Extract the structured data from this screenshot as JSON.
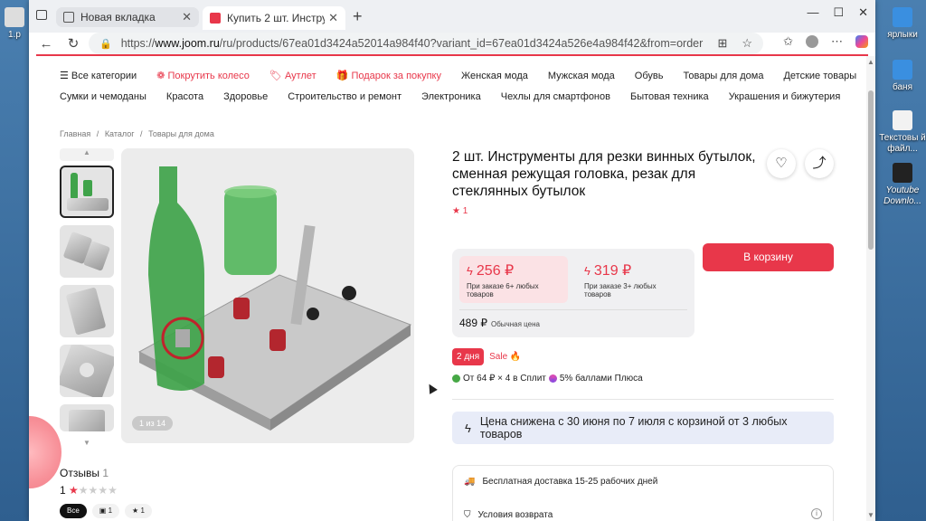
{
  "desktop": {
    "left_icon_label": "1.p",
    "icons": [
      {
        "label": "ярлыки"
      },
      {
        "label": "баня"
      },
      {
        "label": "Текстовы й файл..."
      },
      {
        "label": "Youtube Downlo..."
      }
    ]
  },
  "browser": {
    "tabs": [
      {
        "title": "Новая вкладка"
      },
      {
        "title": "Купить 2 шт. Инструменты д"
      }
    ],
    "address": {
      "prefix": "https://",
      "domain": "www.joom.ru",
      "path": "/ru/products/67ea01d3424a52014a984f40?variant_id=67ea01d3424a526e4a984f42&from=order"
    }
  },
  "catalog_nav": {
    "row1": [
      "Все категории",
      "Покрутить колесо",
      "Аутлет",
      "Подарок за покупку",
      "Женская мода",
      "Мужская мода",
      "Обувь",
      "Товары для дома",
      "Детские товары"
    ],
    "row2": [
      "Сумки и чемоданы",
      "Красота",
      "Здоровье",
      "Строительство и ремонт",
      "Электроника",
      "Чехлы для смартфонов",
      "Бытовая техника",
      "Украшения и бижутерия"
    ]
  },
  "breadcrumbs": [
    "Главная",
    "/",
    "Каталог",
    "/",
    "Товары для дома"
  ],
  "gallery": {
    "counter": "1 из 14"
  },
  "product": {
    "title": "2 шт. Инструменты для резки винных бутылок, сменная режущая головка, резак для стеклянных бутылок",
    "rating": "1"
  },
  "pricing": {
    "tier1_price": "256 ₽",
    "tier1_desc": "При заказе 6+ любых товаров",
    "tier2_price": "319 ₽",
    "tier2_desc": "При заказе 3+ любых товаров",
    "regular_price": "489 ₽",
    "regular_label": "Обычная цена",
    "cart_button": "В корзину"
  },
  "promo": {
    "days": "2 дня",
    "sale": "Sale"
  },
  "split": {
    "text1": "От 64 ₽ × 4 в Сплит",
    "text2": "5% баллами Плюса"
  },
  "price_drop": "Цена снижена с 30 июня по 7 июля с корзиной от 3 любых товаров",
  "delivery": {
    "free": "Бесплатная доставка 15-25 рабочих дней",
    "returns": "Условия возврата"
  },
  "reviews": {
    "heading": "Отзывы",
    "count": "1",
    "rating_value": "1",
    "filters": [
      {
        "label": "Все"
      },
      {
        "label": "1"
      },
      {
        "label": "1"
      }
    ]
  },
  "colors": {
    "accent": "#e8374a",
    "drop_bg": "#e8ecf8"
  }
}
